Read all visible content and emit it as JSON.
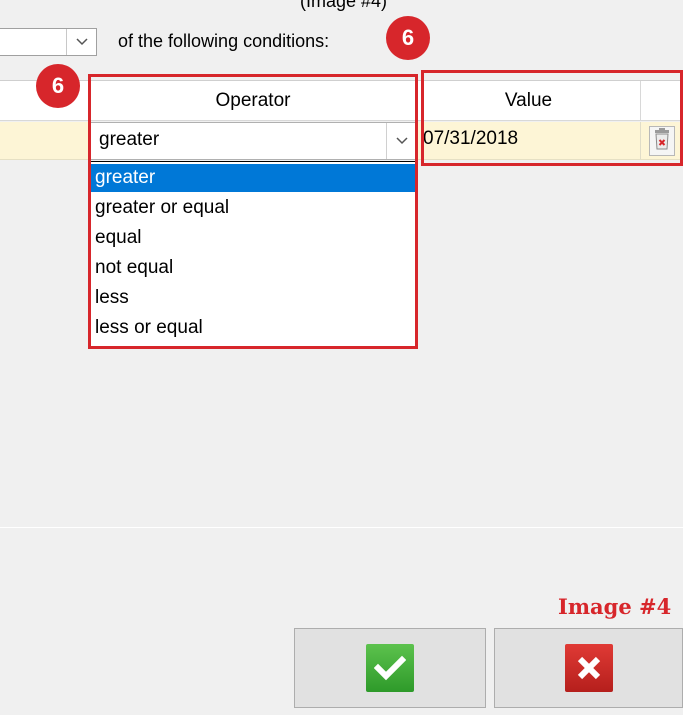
{
  "header": {
    "top_cut_text": "(Image #4)",
    "condition_label": "of the following conditions:",
    "badge_value": "6"
  },
  "grid": {
    "columns": [
      "",
      "Operator",
      "Value",
      ""
    ],
    "row": {
      "operator": "greater",
      "value": "07/31/2018"
    }
  },
  "operator_dropdown": {
    "options": [
      "greater",
      "greater or equal",
      "equal",
      "not equal",
      "less",
      "less or equal"
    ],
    "selected_index": 0
  },
  "annotation": {
    "image_label": "Image #4",
    "accent_color": "#d7262b"
  },
  "buttons": {
    "ok_icon": "checkmark-icon",
    "cancel_icon": "close-icon"
  }
}
